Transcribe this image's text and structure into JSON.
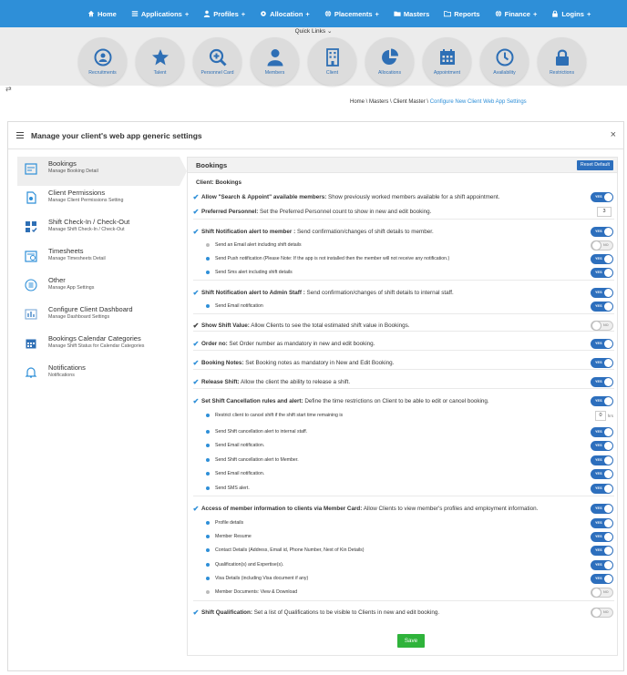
{
  "topnav": {
    "items": [
      {
        "label": "Home",
        "icon": "home-icon"
      },
      {
        "label": "Applications",
        "icon": "list-icon"
      },
      {
        "label": "Profiles",
        "icon": "user-icon"
      },
      {
        "label": "Allocation",
        "icon": "gear-icon"
      },
      {
        "label": "Placements",
        "icon": "globe-icon"
      },
      {
        "label": "Masters",
        "icon": "folder-icon"
      },
      {
        "label": "Reports",
        "icon": "folder-open-icon"
      },
      {
        "label": "Finance",
        "icon": "globe-icon"
      },
      {
        "label": "Logins",
        "icon": "lock-icon"
      }
    ],
    "suffix_plus": "+"
  },
  "quick_links": {
    "label": "Quick Links",
    "items": [
      {
        "label": "Recruitments",
        "icon": "target-user-icon"
      },
      {
        "label": "Talent",
        "icon": "star-icon"
      },
      {
        "label": "Personnel Card",
        "icon": "zoom-plus-icon"
      },
      {
        "label": "Members",
        "icon": "person-icon"
      },
      {
        "label": "Client",
        "icon": "building-icon"
      },
      {
        "label": "Allocations",
        "icon": "pie-icon"
      },
      {
        "label": "Appointment",
        "icon": "calendar-icon"
      },
      {
        "label": "Availability",
        "icon": "clock-icon"
      },
      {
        "label": "Restrictions",
        "icon": "lock-icon"
      }
    ]
  },
  "breadcrumb": {
    "prefix": "Home \\ Masters \\ Client Master \\ ",
    "current": "Configure New Client Web App Settings"
  },
  "panel": {
    "title": "Manage your client's web app generic settings",
    "close": "×"
  },
  "leftnav": [
    {
      "title": "Bookings",
      "sub": "Manage Booking Detail"
    },
    {
      "title": "Client Permissions",
      "sub": "Manage Client Permissions Setting"
    },
    {
      "title": "Shift Check-In / Check-Out",
      "sub": "Manage Shift Check-In / Check-Out"
    },
    {
      "title": "Timesheets",
      "sub": "Manage Timesheets Detail"
    },
    {
      "title": "Other",
      "sub": "Manage App Settings"
    },
    {
      "title": "Configure Client Dashboard",
      "sub": "Manage Dashboard Settings"
    },
    {
      "title": "Bookings Calendar Categories",
      "sub": "Manage Shift Status for Calendar Categories"
    },
    {
      "title": "Notifications",
      "sub": "Notifications"
    }
  ],
  "content": {
    "title": "Bookings",
    "reset": "Reset Default",
    "client_label": "Client: Bookings",
    "yes": "YES",
    "no": "NO",
    "hrs": "hrs",
    "save": "Save",
    "rows": [
      {
        "b": "Allow \"Search & Appoint\" available members:",
        "t": " Show previously worked members available for a shift appointment.",
        "state": "on"
      },
      {
        "b": "Preferred Personnel:",
        "t": " Set the Preferred Personnel count to show in new and edit booking.",
        "value": "3"
      },
      {
        "b": "Shift Notification alert to member :",
        "t": " Send confirmation/changes of shift details to member.",
        "state": "on"
      },
      {
        "t": "Send an Email alert including shift details",
        "state": "off"
      },
      {
        "t": "Send Push notification (Please Note: If the app is not installed then the member will not receive any notification.)",
        "state": "on"
      },
      {
        "t": "Send Sms alert including shift details",
        "state": "on"
      },
      {
        "b": "Shift Notification alert to Admin Staff :",
        "t": " Send confirmation/changes of shift details to internal staff.",
        "state": "on"
      },
      {
        "t": "Send Email notification",
        "state": "on"
      },
      {
        "b": "Show Shift Value:",
        "t": " Allow Clients to see the total estimated shift value in Bookings.",
        "state": "off"
      },
      {
        "b": "Order no:",
        "t": " Set Order number as mandatory in new and edit booking.",
        "state": "on"
      },
      {
        "b": "Booking Notes:",
        "t": " Set Booking notes as mandatory in New and Edit Booking.",
        "state": "on"
      },
      {
        "b": "Release Shift:",
        "t": " Allow the client the ability to release a shift.",
        "state": "on"
      },
      {
        "b": "Set Shift Cancellation rules and alert:",
        "t": " Define the time restrictions on Client to be able to edit or cancel booking.",
        "state": "on"
      },
      {
        "t": "Restrict client to cancel shift if the shift start time remaining is",
        "value": "0"
      },
      {
        "t": "Send Shift cancellation alert to internal staff.",
        "state": "on"
      },
      {
        "t": "Send Email notification.",
        "state": "on"
      },
      {
        "t": "Send Shift cancellation alert to Member.",
        "state": "on"
      },
      {
        "t": "Send Email notification.",
        "state": "on"
      },
      {
        "t": "Send SMS alert.",
        "state": "on"
      },
      {
        "b": "Access of member information to clients via Member Card:",
        "t": " Allow Clients to view member's profiles and employment information.",
        "state": "on"
      },
      {
        "t": "Profile details",
        "state": "on"
      },
      {
        "t": "Member Resume",
        "state": "on"
      },
      {
        "t": "Contact Details (Address, Email id, Phone Number, Next of Kin Details)",
        "state": "on"
      },
      {
        "t": "Qualification(s) and Expertise(s).",
        "state": "on"
      },
      {
        "t": "Visa Details (including Visa document if any)",
        "state": "on"
      },
      {
        "t": "Member Documents: View & Download",
        "state": "off"
      },
      {
        "b": "Shift Qualification:",
        "t": " Set a list of Qualifications to be visible to Clients in new and edit booking.",
        "state": "off"
      }
    ]
  },
  "colors": {
    "nav": "#2e8fd8",
    "toggle_on": "#2d6fbd",
    "save": "#2fb33b",
    "quick_bg": "#ececec"
  }
}
